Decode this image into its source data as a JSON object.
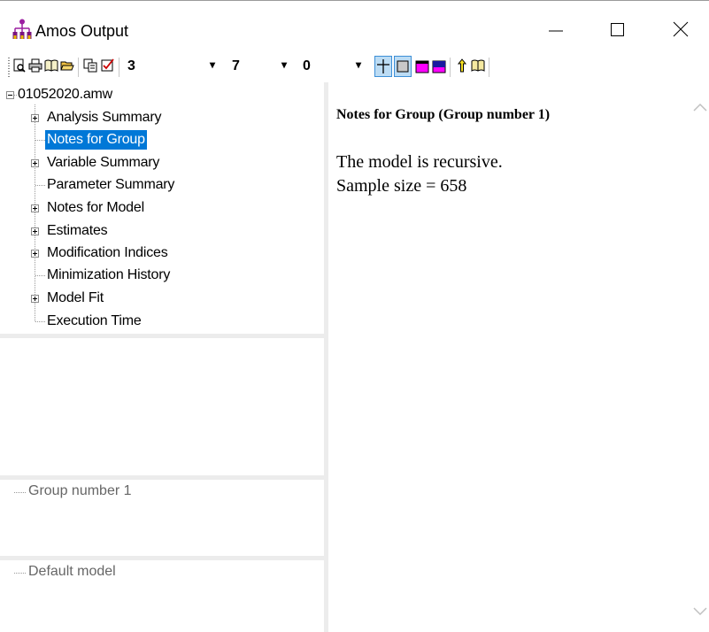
{
  "window": {
    "title": "Amos Output",
    "icon": "amos-app-icon"
  },
  "toolbar": {
    "combo_decimals": "3",
    "combo_width": "7",
    "combo_third": "0",
    "icons": [
      "print-preview-icon",
      "print-icon",
      "book-icon",
      "open-folder-icon",
      "copy-icon",
      "options-icon",
      "grid-lines-icon",
      "table-border-icon",
      "magenta-table-icon",
      "blue-table-icon",
      "up-pointer-icon",
      "help-book-icon"
    ]
  },
  "tree": {
    "root": "01052020.amw",
    "items": [
      {
        "label": "Analysis Summary",
        "expandable": true
      },
      {
        "label": "Notes for Group",
        "expandable": false,
        "selected": true
      },
      {
        "label": "Variable Summary",
        "expandable": true
      },
      {
        "label": "Parameter Summary",
        "expandable": false
      },
      {
        "label": "Notes for Model",
        "expandable": true
      },
      {
        "label": "Estimates",
        "expandable": true
      },
      {
        "label": "Modification Indices",
        "expandable": true
      },
      {
        "label": "Minimization History",
        "expandable": false
      },
      {
        "label": "Model Fit",
        "expandable": true
      },
      {
        "label": "Execution Time",
        "expandable": false
      }
    ]
  },
  "groups": {
    "group_label": "Group number 1",
    "model_label": "Default model"
  },
  "content": {
    "heading": "Notes for Group (Group number 1)",
    "line1": "The model is recursive.",
    "line2": "Sample size = 658"
  },
  "colors": {
    "selection": "#0078d7",
    "pane_splitter": "#ececec",
    "toggle_active": "#bcdcf4"
  }
}
